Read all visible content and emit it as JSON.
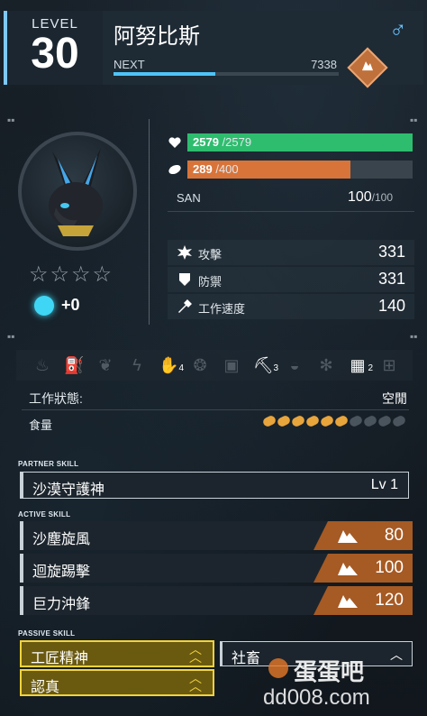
{
  "header": {
    "level_label": "LEVEL",
    "level": "30",
    "name": "阿努比斯",
    "gender": "♂",
    "next_label": "NEXT",
    "next_value": "7338",
    "exp_progress": 0.45,
    "element_icon": "ground-element-icon"
  },
  "profile": {
    "stars_total": 4,
    "stars_filled": 0,
    "soul_value": "+0"
  },
  "vitals": {
    "hp": {
      "current": "2579",
      "max": "/2579",
      "ratio": 1.0,
      "color": "#2ebd6e"
    },
    "hunger": {
      "current": "289",
      "max": "/400",
      "ratio": 0.7225,
      "color": "#d8743a"
    },
    "san": {
      "label": "SAN",
      "current": "100",
      "max": "/100"
    }
  },
  "stats": [
    {
      "icon": "attack-icon",
      "label": "攻擊",
      "value": "331"
    },
    {
      "icon": "defense-icon",
      "label": "防禦",
      "value": "331"
    },
    {
      "icon": "work-speed-icon",
      "label": "工作速度",
      "value": "140"
    }
  ],
  "work": {
    "icons": [
      {
        "name": "kindling-icon",
        "glyph": "♨",
        "active": false,
        "level": ""
      },
      {
        "name": "watering-icon",
        "glyph": "⛽",
        "active": false,
        "level": ""
      },
      {
        "name": "planting-icon",
        "glyph": "❦",
        "active": false,
        "level": ""
      },
      {
        "name": "electricity-icon",
        "glyph": "ϟ",
        "active": false,
        "level": ""
      },
      {
        "name": "handiwork-icon",
        "glyph": "✋",
        "active": true,
        "level": "4"
      },
      {
        "name": "gathering-icon",
        "glyph": "❂",
        "active": false,
        "level": ""
      },
      {
        "name": "lumbering-icon",
        "glyph": "▣",
        "active": false,
        "level": ""
      },
      {
        "name": "mining-icon",
        "glyph": "⛏",
        "active": true,
        "level": "3"
      },
      {
        "name": "medicine-icon",
        "glyph": "◒",
        "active": false,
        "level": ""
      },
      {
        "name": "cooling-icon",
        "glyph": "✻",
        "active": false,
        "level": ""
      },
      {
        "name": "transporting-icon",
        "glyph": "▦",
        "active": true,
        "level": "2"
      },
      {
        "name": "farming-icon",
        "glyph": "⊞",
        "active": false,
        "level": ""
      }
    ],
    "state_label": "工作狀態:",
    "state_value": "空閒",
    "food_label": "食量",
    "food_total": 10,
    "food_filled": 6
  },
  "skills": {
    "partner_label": "PARTNER SKILL",
    "partner": {
      "name": "沙漠守護神",
      "level": "Lv  1"
    },
    "active_label": "ACTIVE SKILL",
    "active": [
      {
        "name": "沙塵旋風",
        "power": "80"
      },
      {
        "name": "迴旋踢擊",
        "power": "100"
      },
      {
        "name": "巨力沖鋒",
        "power": "120"
      }
    ],
    "passive_label": "PASSIVE SKILL",
    "passive": [
      {
        "name": "工匠精神",
        "rank": "gold"
      },
      {
        "name": "認真",
        "rank": "gold"
      },
      {
        "name": "社畜",
        "rank": "white"
      }
    ]
  },
  "watermark": {
    "logo": "蛋蛋吧",
    "url": "dd008.com"
  },
  "colors": {
    "accent": "#7ec8f3",
    "hp": "#2ebd6e",
    "hunger": "#d8743a",
    "skill_power": "#a65a24",
    "passive_gold": "#f2d33c"
  }
}
